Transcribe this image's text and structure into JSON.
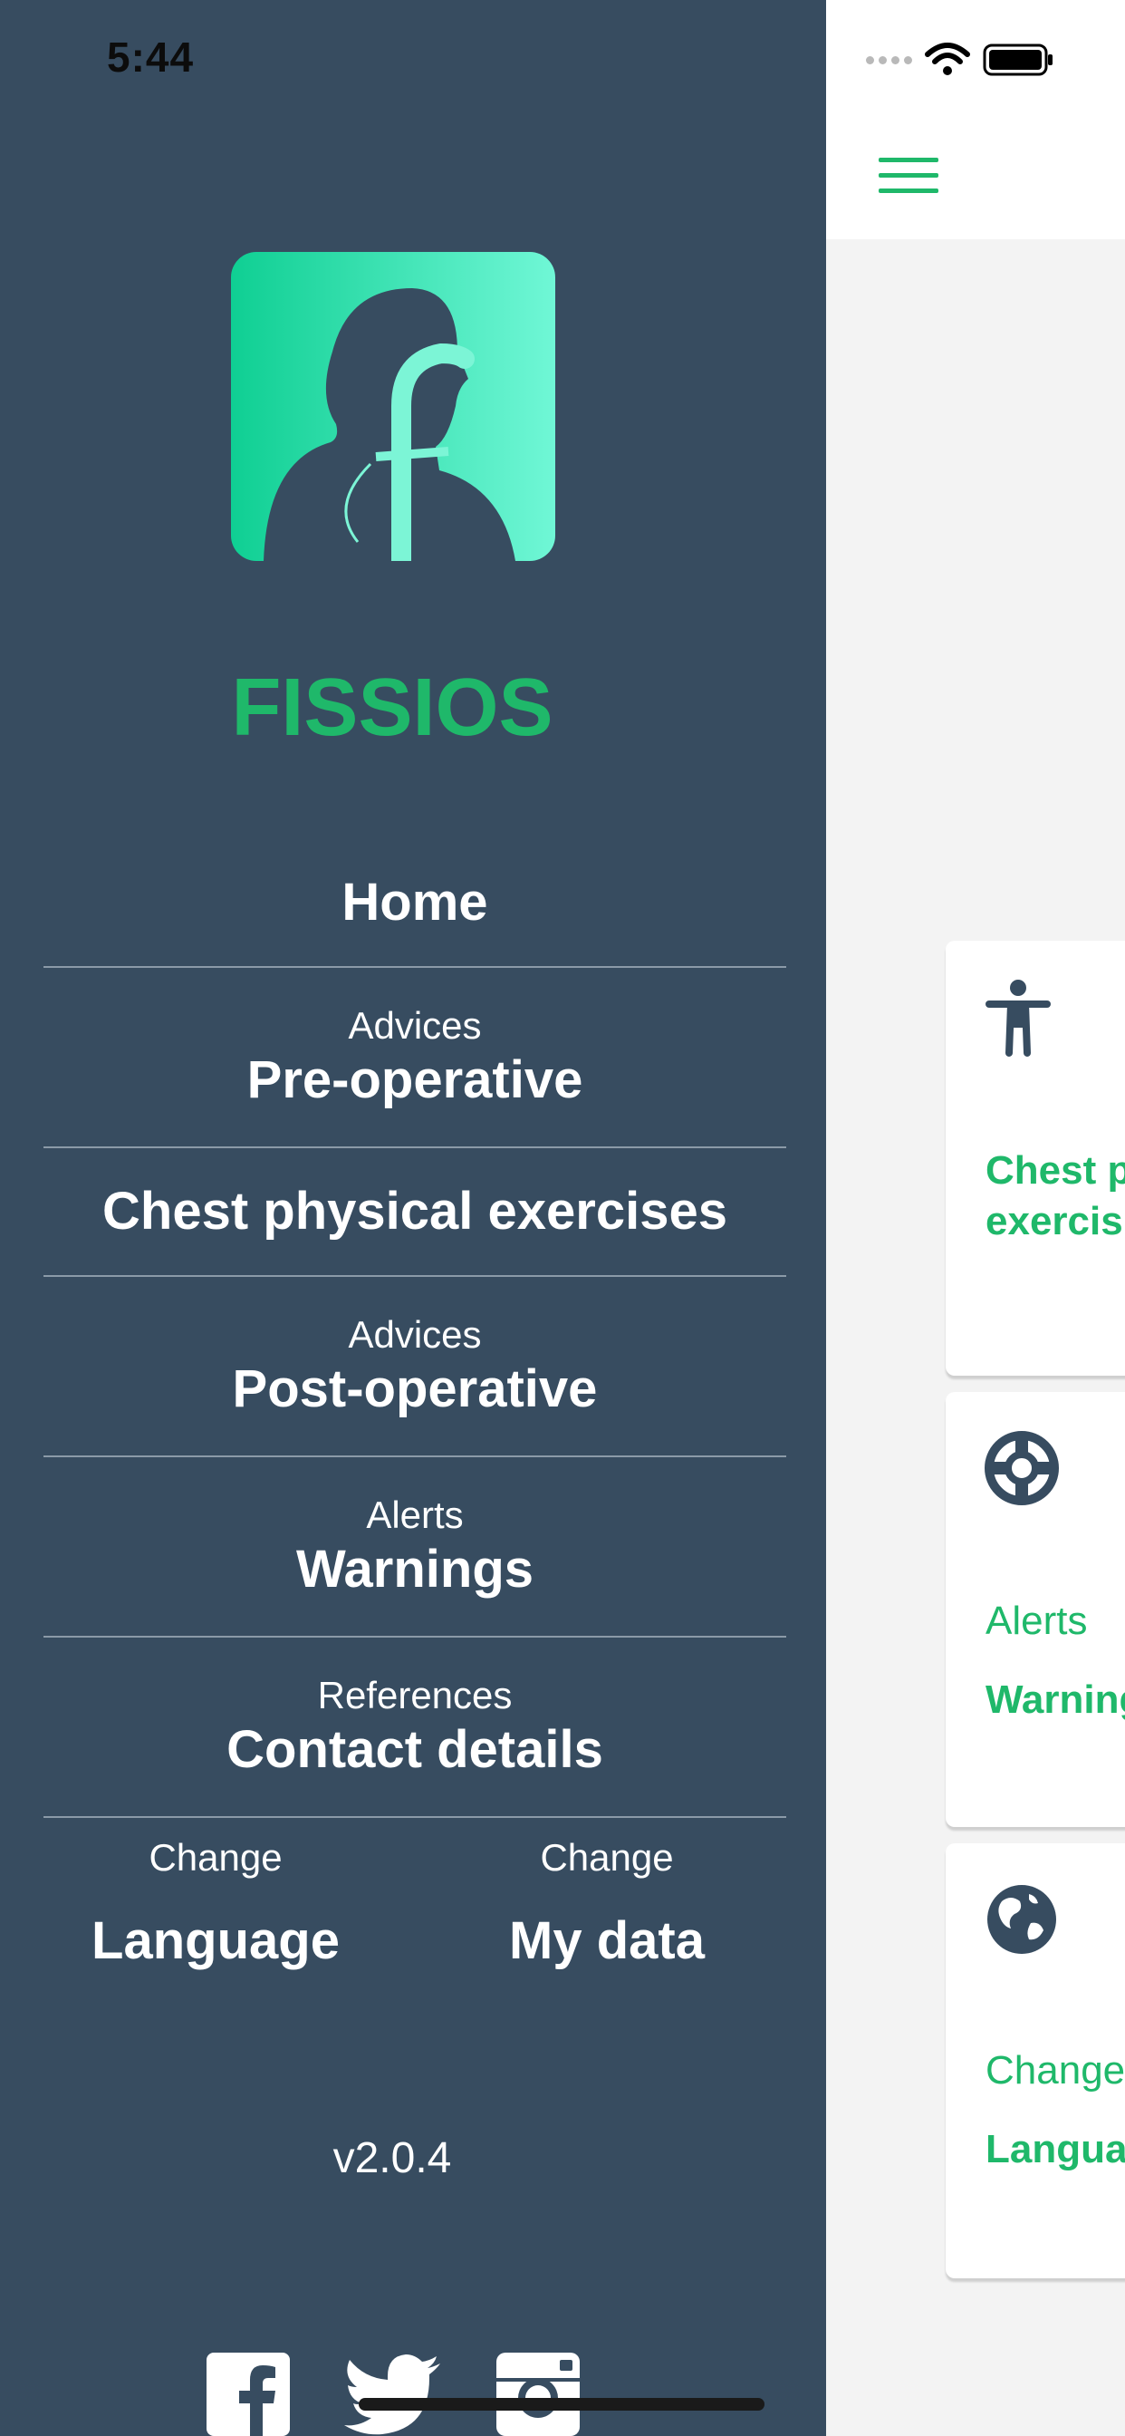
{
  "status": {
    "time": "5:44"
  },
  "app": {
    "name": "FISSIOS",
    "version": "v2.0.4"
  },
  "menu": {
    "home": {
      "label": "Home"
    },
    "pre": {
      "sub": "Advices",
      "label": "Pre-operative"
    },
    "chest": {
      "label": "Chest physical exercises"
    },
    "post": {
      "sub": "Advices",
      "label": "Post-operative"
    },
    "warnings": {
      "sub": "Alerts",
      "label": "Warnings"
    },
    "contact": {
      "sub": "References",
      "label": "Contact details"
    },
    "language": {
      "sub": "Change",
      "label": "Language"
    },
    "mydata": {
      "sub": "Change",
      "label": "My data"
    }
  },
  "main": {
    "cards": [
      {
        "icon": "person-icon",
        "title_line1": "Chest p",
        "title_line2": "exercis"
      },
      {
        "icon": "lifebuoy-icon",
        "sub": "Alerts",
        "title": "Warning"
      },
      {
        "icon": "globe-icon",
        "sub": "Change",
        "title": "Langua"
      }
    ]
  },
  "social": [
    "facebook-icon",
    "twitter-icon",
    "instagram-icon"
  ],
  "colors": {
    "drawer_bg": "#374c60",
    "accent": "#1fb86a",
    "divider": "#8b9aa8"
  }
}
